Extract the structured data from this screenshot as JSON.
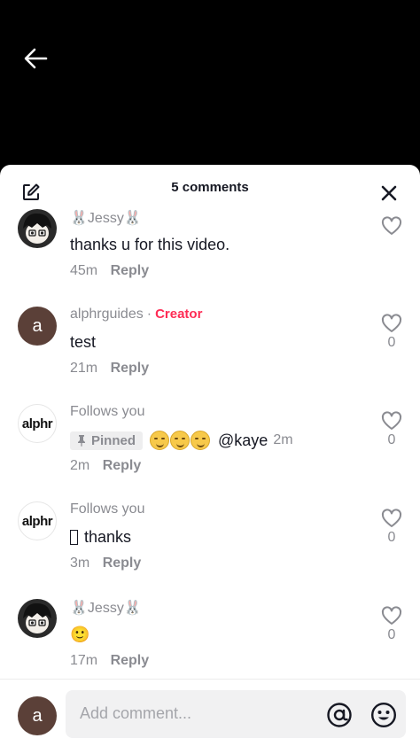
{
  "header": {
    "title": "5 comments"
  },
  "comments": [
    {
      "username": "🐰Jessy🐰",
      "text": "thanks u for this video.",
      "time": "45m",
      "reply": "Reply",
      "likes": ""
    },
    {
      "username": "alphrguides",
      "dot": "·",
      "badge": "Creator",
      "text": "test",
      "time": "21m",
      "reply": "Reply",
      "likes": "0"
    },
    {
      "avatar_text": "alphr",
      "username": "Follows you",
      "pinned": "Pinned",
      "mention": "@kaye",
      "inline_time": "2m",
      "time": "2m",
      "reply": "Reply",
      "likes": "0"
    },
    {
      "avatar_text": "alphr",
      "username": "Follows you",
      "text": "thanks",
      "time": "3m",
      "reply": "Reply",
      "likes": "0"
    },
    {
      "username": "🐰Jessy🐰",
      "text": "🙂",
      "time": "17m",
      "reply": "Reply",
      "likes": "0"
    }
  ],
  "avatars": {
    "letter": "a"
  },
  "composer": {
    "placeholder": "Add comment...",
    "avatar_letter": "a"
  },
  "colors": {
    "accent": "#fe2c55",
    "muted": "#8a8b91",
    "text": "#161823"
  }
}
